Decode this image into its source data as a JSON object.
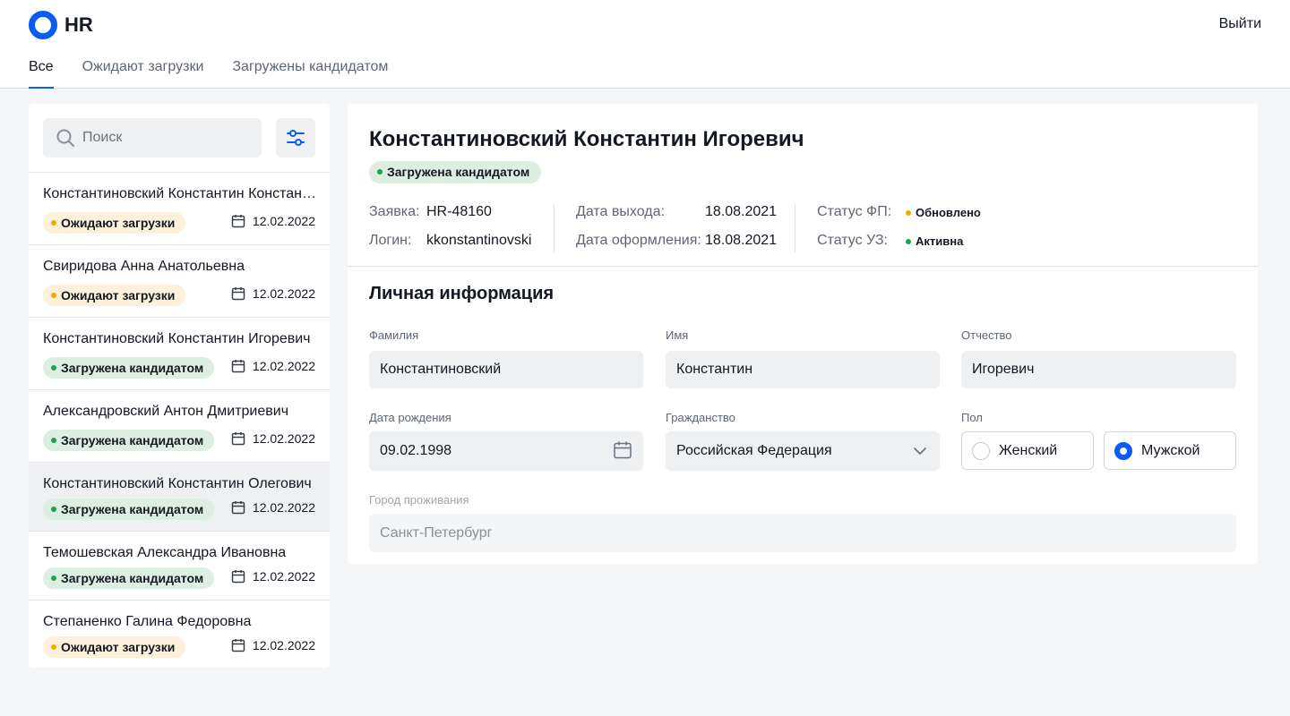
{
  "app": {
    "logo_text": "HR",
    "logout_label": "Выйти"
  },
  "tabs": [
    {
      "label": "Все",
      "active": true
    },
    {
      "label": "Ожидают загрузки",
      "active": false
    },
    {
      "label": "Загружены кандидатом",
      "active": false
    }
  ],
  "sidebar": {
    "search_placeholder": "Поиск",
    "items": [
      {
        "name": "Константиновский Константин Константинович",
        "status": "Ожидают загрузки",
        "status_color": "yellow",
        "date": "12.02.2022"
      },
      {
        "name": "Свиридова Анна Анатольевна",
        "status": "Ожидают загрузки",
        "status_color": "yellow",
        "date": "12.02.2022"
      },
      {
        "name": "Константиновский Константин Игоревич",
        "status": "Загружена кандидатом",
        "status_color": "green",
        "date": "12.02.2022"
      },
      {
        "name": "Александровский Антон Дмитриевич",
        "status": "Загружена кандидатом",
        "status_color": "green",
        "date": "12.02.2022"
      },
      {
        "name": "Константиновский Константин Олегович",
        "status": "Загружена кандидатом",
        "status_color": "green",
        "date": "12.02.2022",
        "selected": true
      },
      {
        "name": "Темошевская Александра Ивановна",
        "status": "Загружена кандидатом",
        "status_color": "green",
        "date": "12.02.2022"
      },
      {
        "name": "Степаненко Галина Федоровна",
        "status": "Ожидают загрузки",
        "status_color": "yellow",
        "date": "12.02.2022"
      }
    ]
  },
  "detail": {
    "full_name": "Константиновский Константин Игоревич",
    "status": "Загружена кандидатом",
    "meta": {
      "request_label": "Заявка:",
      "request_value": "HR-48160",
      "login_label": "Логин:",
      "login_value": "kkonstantinovski",
      "start_date_label": "Дата выхода:",
      "start_date_value": "18.08.2021",
      "hire_date_label": "Дата оформления:",
      "hire_date_value": "18.08.2021",
      "fp_status_label": "Статус ФП:",
      "fp_status_value": "Обновлено",
      "uz_status_label": "Статус УЗ:",
      "uz_status_value": "Активна"
    },
    "personal": {
      "title": "Личная информация",
      "last_name_label": "Фамилия",
      "last_name": "Константиновский",
      "first_name_label": "Имя",
      "first_name": "Константин",
      "middle_name_label": "Отчество",
      "middle_name": "Игоревич",
      "birth_date_label": "Дата рождения",
      "birth_date": "09.02.1998",
      "citizenship_label": "Гражданство",
      "citizenship": "Российская Федерация",
      "gender_label": "Пол",
      "gender_female": "Женский",
      "gender_male": "Мужской",
      "gender_selected": "male",
      "city_label": "Город проживания",
      "city": "Санкт-Петербург"
    }
  },
  "colors": {
    "accent": "#0b5cf2",
    "status_yellow": "#f2a900",
    "status_green": "#1aa34a"
  }
}
